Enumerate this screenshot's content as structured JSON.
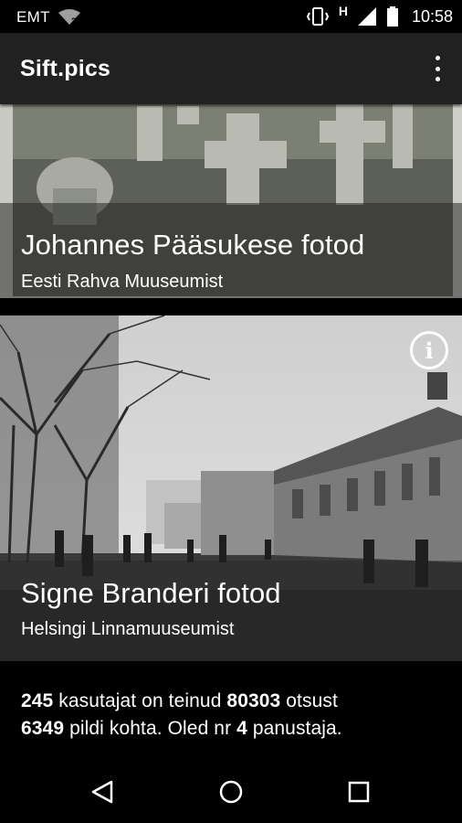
{
  "status_bar": {
    "carrier": "EMT",
    "network_type": "H",
    "time": "10:58",
    "icons": [
      "wifi-question-icon",
      "vibrate-icon",
      "signal-icon",
      "battery-icon"
    ]
  },
  "app_bar": {
    "title": "Sift.pics",
    "menu_icon": "more-vert-icon"
  },
  "cards": [
    {
      "title": "Johannes Pääsukese fotod",
      "subtitle": "Eesti Rahva Muuseumist"
    },
    {
      "title": "Signe Branderi fotod",
      "subtitle": "Helsingi Linnamuuseumist",
      "info_icon": "info-icon"
    }
  ],
  "stats": {
    "users": "245",
    "text_users": "kasutajat on teinud",
    "decisions": "80303",
    "text_decisions": "otsust",
    "images": "6349",
    "text_images": "pildi kohta. Oled nr",
    "rank": "4",
    "text_rank": "panustaja."
  },
  "nav_bar": {
    "icons": [
      "back-icon",
      "home-icon",
      "recents-icon"
    ]
  },
  "colors": {
    "app_bar": "#212121",
    "background": "#000000",
    "text": "#ffffff"
  }
}
